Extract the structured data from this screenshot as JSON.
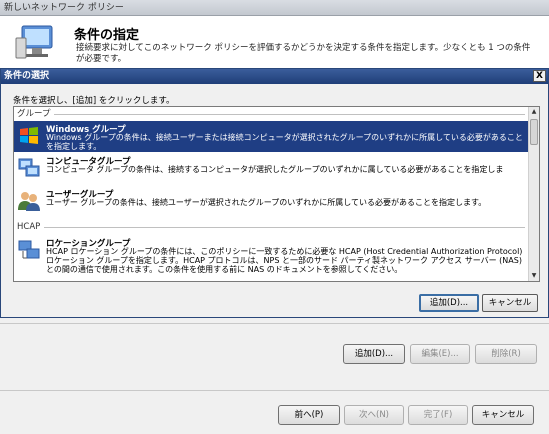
{
  "outer": {
    "window_title": "新しいネットワーク ポリシー",
    "heading": "条件の指定",
    "description": "接続要求に対してこのネットワーク ポリシーを評価するかどうかを決定する条件を指定します。少なくとも 1 つの条件が必要です。",
    "buttons": {
      "add": "追加(D)...",
      "edit": "編集(E)...",
      "remove": "削除(R)",
      "back": "前へ(P)",
      "next": "次へ(N)",
      "finish": "完了(F)",
      "cancel": "キャンセル"
    }
  },
  "dialog": {
    "title": "条件の選択",
    "close_label": "X",
    "instruction": "条件を選択し、[追加] をクリックします。",
    "groups": [
      {
        "name": "グループ",
        "items": [
          {
            "title": "Windows グループ",
            "description": "Windows グループの条件は、接続ユーザーまたは接続コンピュータが選択されたグループのいずれかに所属している必要があることを指定します。",
            "icon": "windows-group-icon",
            "selected": true
          },
          {
            "title": "コンピュータグループ",
            "description": "コンピュータ グループの条件は、接続するコンピュータが選択したグループのいずれかに属している必要があることを指定しま",
            "icon": "computer-group-icon",
            "selected": false
          },
          {
            "title": "ユーザーグループ",
            "description": "ユーザー グループの条件は、接続ユーザーが選択されたグループのいずれかに所属している必要があることを指定します。",
            "icon": "user-group-icon",
            "selected": false
          }
        ]
      },
      {
        "name": "HCAP",
        "items": [
          {
            "title": "ロケーショングループ",
            "description": "HCAP ロケーション グループの条件には、このポリシーに一致するために必要な HCAP (Host Credential Authorization Protocol) ロケーション グループを指定します。HCAP プロトコルは、NPS と一部のサード パーティ製ネットワーク アクセス サーバー (NAS) との間の通信で使用されます。この条件を使用する前に NAS のドキュメントを参照してください。",
            "icon": "location-group-icon",
            "selected": false
          }
        ]
      }
    ],
    "add_button": "追加(D)...",
    "cancel_button": "キャンセル"
  },
  "colors": {
    "selection": "#1f3e84",
    "dialog_title": "#2a4a85"
  }
}
